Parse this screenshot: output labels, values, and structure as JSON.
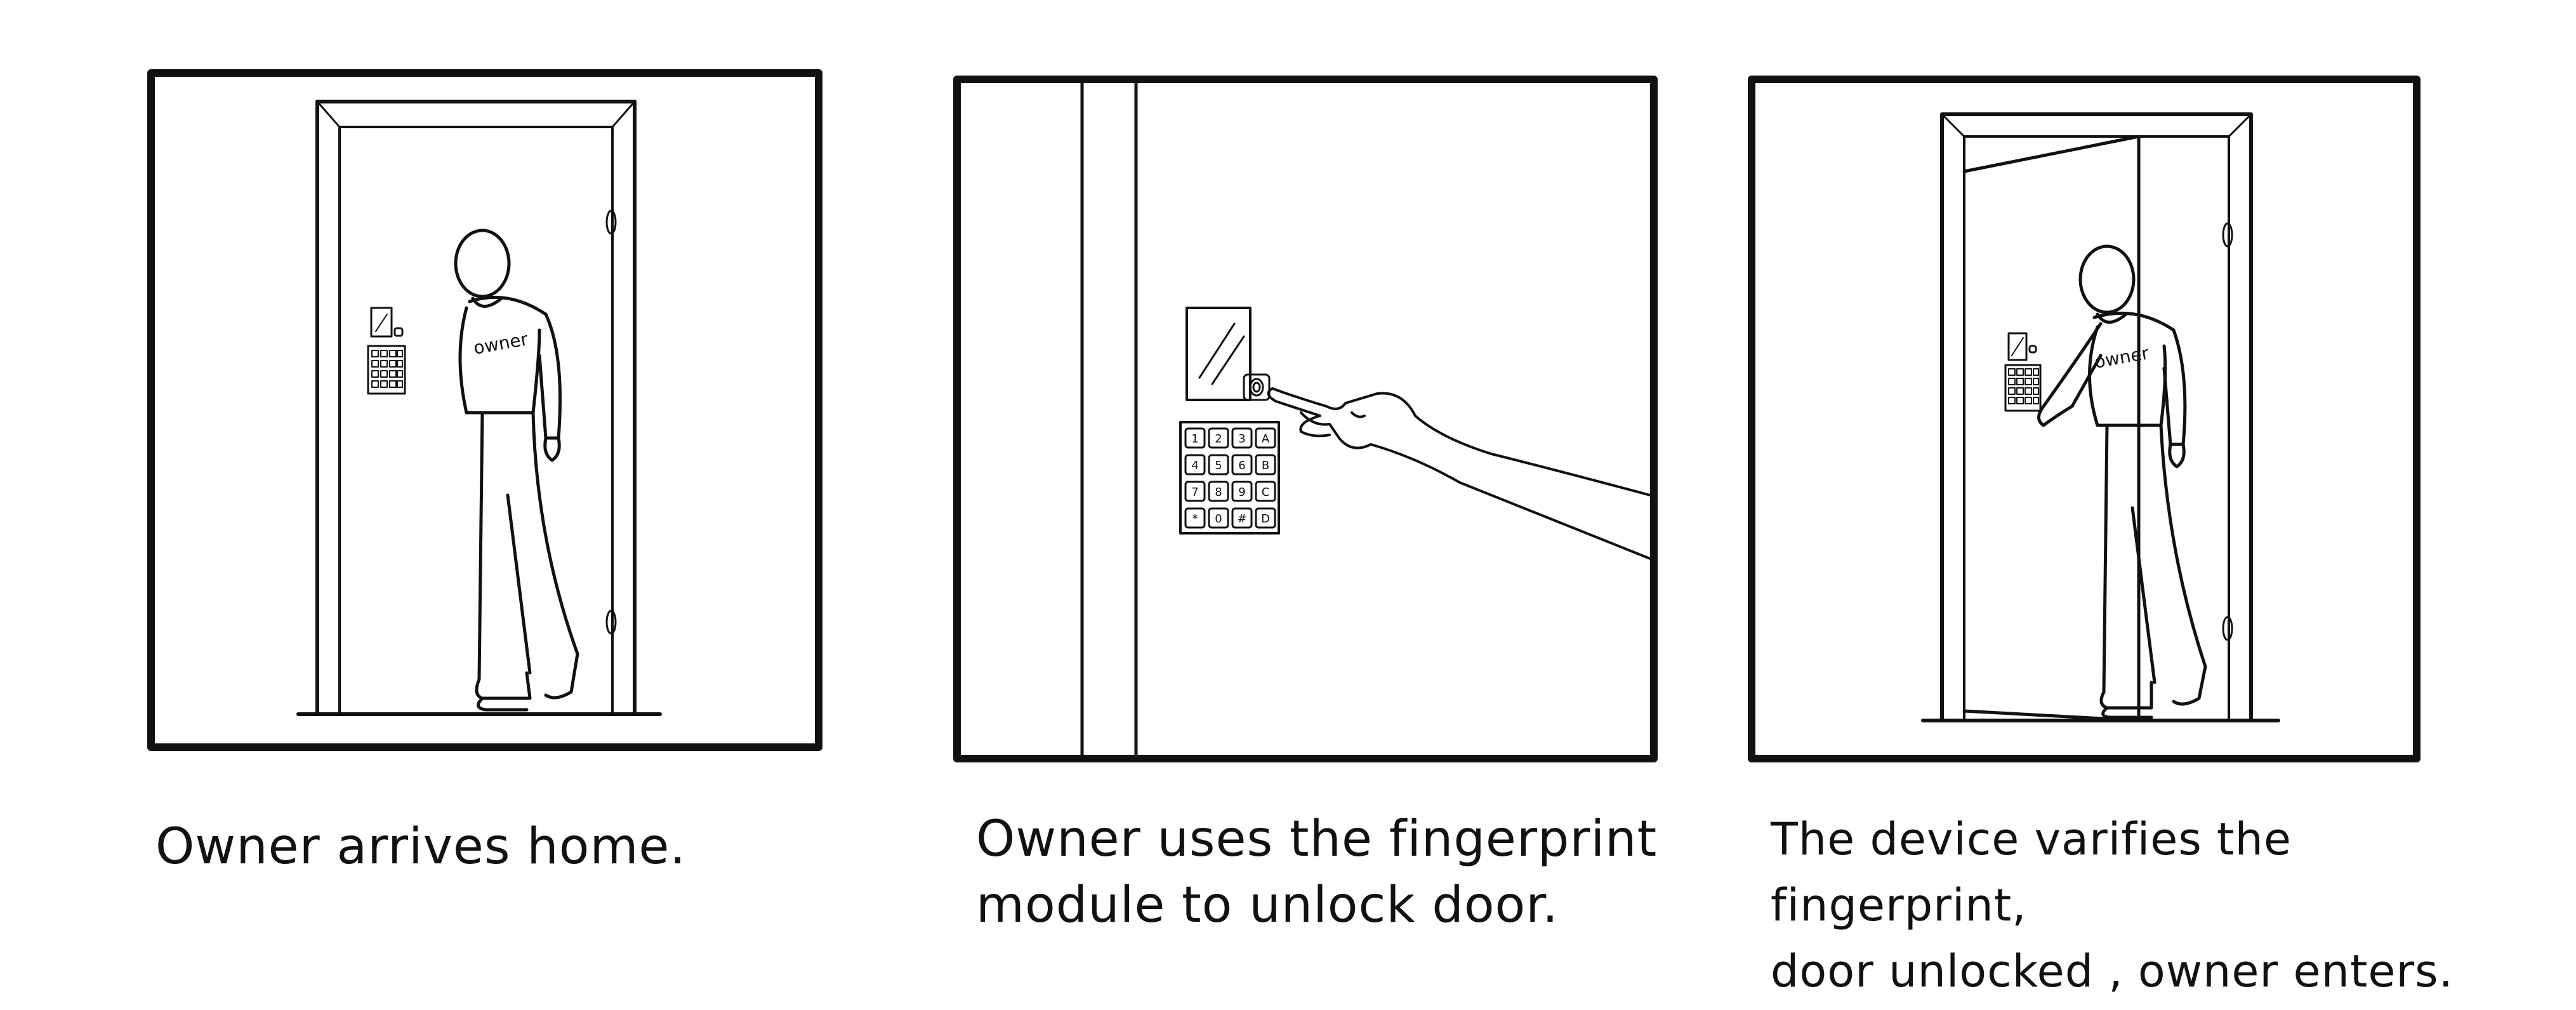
{
  "storyboard": {
    "panels": [
      {
        "id": "panel-1",
        "shirt_label": "owner",
        "caption": "Owner arrives home."
      },
      {
        "id": "panel-2",
        "keypad_keys": [
          "1",
          "2",
          "3",
          "A",
          "4",
          "5",
          "6",
          "B",
          "7",
          "8",
          "9",
          "C",
          "*",
          "0",
          "#",
          "D"
        ],
        "caption": "Owner uses the fingerprint\nmodule to unlock door."
      },
      {
        "id": "panel-3",
        "shirt_label": "owner",
        "caption": "The device varifies the fingerprint,\ndoor unlocked , owner enters."
      }
    ]
  }
}
